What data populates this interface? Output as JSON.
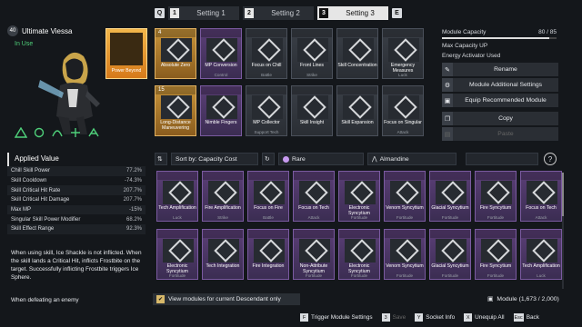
{
  "tabs": {
    "prev_key": "Q",
    "next_key": "E",
    "items": [
      {
        "num": "1",
        "label": "Setting 1"
      },
      {
        "num": "2",
        "label": "Setting 2"
      },
      {
        "num": "3",
        "label": "Setting 3"
      }
    ]
  },
  "character": {
    "level": "40",
    "name": "Ultimate Viessa",
    "status": "In Use",
    "beyond_label": "Power Beyond"
  },
  "equipped": {
    "row1": [
      {
        "cost": "4",
        "name": "Absolute Zero",
        "sub": ""
      },
      {
        "cost": "",
        "name": "MP Conversion",
        "sub": "Control"
      },
      {
        "cost": "",
        "name": "Focus on Chill",
        "sub": "Battle"
      },
      {
        "cost": "",
        "name": "Front Lines",
        "sub": "Strike"
      },
      {
        "cost": "",
        "name": "Skill Concentration",
        "sub": ""
      },
      {
        "cost": "",
        "name": "Emergency Measures",
        "sub": "Luck"
      }
    ],
    "row2": [
      {
        "cost": "15",
        "name": "Long-Distance Maneuvering",
        "sub": ""
      },
      {
        "cost": "",
        "name": "Nimble Fingers",
        "sub": ""
      },
      {
        "cost": "",
        "name": "MP Collector",
        "sub": "Support Tech"
      },
      {
        "cost": "",
        "name": "Skill Insight",
        "sub": ""
      },
      {
        "cost": "",
        "name": "Skill Expansion",
        "sub": ""
      },
      {
        "cost": "",
        "name": "Focus on Singular",
        "sub": "Attack"
      }
    ]
  },
  "capacity": {
    "module_capacity_label": "Module Capacity",
    "module_capacity_value": "80 / 85",
    "max_capacity_label": "Max Capacity UP",
    "activator_label": "Energy Activator Used",
    "rename": "Rename",
    "additional": "Module Additional Settings",
    "recommended": "Equip Recommended Module",
    "copy": "Copy",
    "paste": "Paste"
  },
  "applied": {
    "title": "Applied Value",
    "rows": [
      {
        "k": "Chill Skill Power",
        "v": "77.2%"
      },
      {
        "k": "Skill Cooldown",
        "v": "-74.3%"
      },
      {
        "k": "Skill Critical Hit Rate",
        "v": "207.7%"
      },
      {
        "k": "Skill Critical Hit Damage",
        "v": "207.7%"
      },
      {
        "k": "Max MP",
        "v": "-15%"
      },
      {
        "k": "Singular Skill Power Modifier",
        "v": "68.2%"
      },
      {
        "k": "Skill Effect Range",
        "v": "92.3%"
      }
    ],
    "desc": "When using skill, Ice Shackle is not inflicted. When the skill lands a Critical Hit, inflicts Frostbite on the target. Successfully inflicting Frostbite triggers Ice Sphere.",
    "desc2": "When defeating an enemy"
  },
  "filters": {
    "sort": "Sort by: Capacity Cost",
    "rarity": "Rare",
    "socket": "Almandine"
  },
  "inventory": {
    "row1": [
      {
        "name": "Tech Amplification",
        "sub": "Luck"
      },
      {
        "name": "Fire Amplification",
        "sub": "Strike"
      },
      {
        "name": "Focus on Fire",
        "sub": "Battle"
      },
      {
        "name": "Focus on Tech",
        "sub": "Attack"
      },
      {
        "name": "Electronic Syncytium",
        "sub": "Fortitude"
      },
      {
        "name": "Venom Syncytium",
        "sub": "Fortitude"
      },
      {
        "name": "Glacial Syncytium",
        "sub": "Fortitude"
      },
      {
        "name": "Fire Syncytium",
        "sub": "Fortitude"
      },
      {
        "name": "Focus on Tech",
        "sub": "Attack"
      }
    ],
    "row2": [
      {
        "name": "Electronic Syncytium",
        "sub": "Fortitude"
      },
      {
        "name": "Tech Integration",
        "sub": ""
      },
      {
        "name": "Fire Integration",
        "sub": ""
      },
      {
        "name": "Non-Attribute Syncytium",
        "sub": "Fortitude"
      },
      {
        "name": "Electronic Syncytium",
        "sub": "Fortitude"
      },
      {
        "name": "Venom Syncytium",
        "sub": "Fortitude"
      },
      {
        "name": "Glacial Syncytium",
        "sub": "Fortitude"
      },
      {
        "name": "Fire Syncytium",
        "sub": "Fortitude"
      },
      {
        "name": "Tech Amplification",
        "sub": "Luck"
      }
    ]
  },
  "bottom": {
    "view_label": "View modules for current Descendant only",
    "module_count": "Module (1,673 / 2,000)"
  },
  "footer": {
    "trigger": "Trigger Module Settings",
    "save": "Save",
    "socket": "Socket Info",
    "unequip": "Unequip All",
    "back": "Back",
    "key_trigger": "F",
    "key_save": "3",
    "key_socket": "Y",
    "key_unequip": "X",
    "key_back": "Esc"
  }
}
